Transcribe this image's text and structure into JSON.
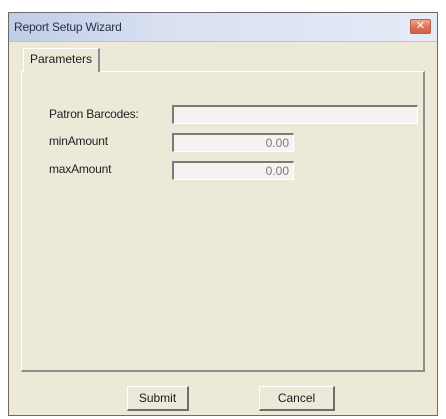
{
  "window": {
    "title": "Report Setup Wizard",
    "close_glyph": "✕"
  },
  "tabs": [
    {
      "label": "Parameters",
      "selected": true
    }
  ],
  "form": {
    "patron_barcodes": {
      "label": "Patron Barcodes:",
      "value": ""
    },
    "min_amount": {
      "label": "minAmount",
      "value": "0.00"
    },
    "max_amount": {
      "label": "maxAmount",
      "value": "0.00"
    }
  },
  "buttons": {
    "submit": "Submit",
    "cancel": "Cancel"
  },
  "colors": {
    "title_bar": "#d8e0f1",
    "close_button": "#e0705a",
    "dialog_face": "#ece9d8",
    "input_background": "#f7f1f1"
  }
}
